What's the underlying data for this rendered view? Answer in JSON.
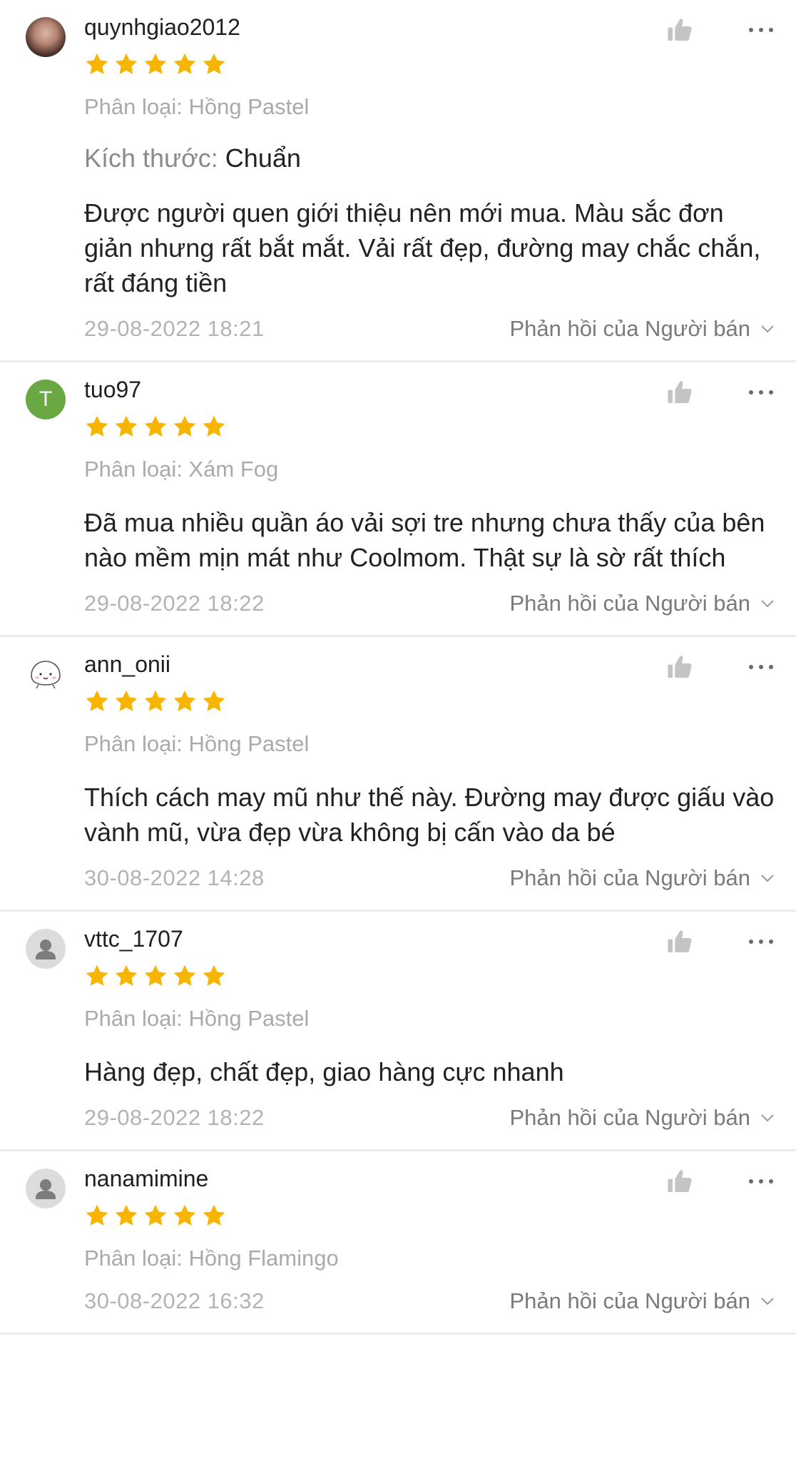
{
  "colors": {
    "star": "#f7b500",
    "letter_avatar_bg": "#6aa843",
    "default_avatar_bg": "#dcdcdc",
    "divider": "#ececec",
    "muted_text": "#aaaaaa"
  },
  "reviews": [
    {
      "username": "quynhgiao2012",
      "avatar_type": "photo",
      "avatar_letter": "",
      "rating": 5,
      "variation": "Phân loại: Hồng Pastel",
      "spec_key": "Kích thước:",
      "spec_value": "Chuẩn",
      "comment": "Được người quen giới thiệu nên mới mua. Màu sắc đơn giản nhưng rất bắt mắt. Vải rất đẹp, đường may chắc chắn, rất đáng tiền",
      "timestamp": "29-08-2022 18:21",
      "seller_reply_label": "Phản hồi của Người bán"
    },
    {
      "username": "tuo97",
      "avatar_type": "letter",
      "avatar_letter": "T",
      "rating": 5,
      "variation": "Phân loại: Xám Fog",
      "comment": "Đã mua nhiều quần áo vải sợi tre nhưng chưa thấy của bên nào mềm mịn mát như Coolmom. Thật sự là sờ rất thích",
      "timestamp": "29-08-2022 18:22",
      "seller_reply_label": "Phản hồi của Người bán"
    },
    {
      "username": "ann_onii",
      "avatar_type": "doodle",
      "avatar_letter": "",
      "rating": 5,
      "variation": "Phân loại: Hồng Pastel",
      "comment": "Thích cách may mũ như thế này. Đường may được giấu vào vành mũ, vừa đẹp vừa không bị cấn vào da bé",
      "timestamp": "30-08-2022 14:28",
      "seller_reply_label": "Phản hồi của Người bán"
    },
    {
      "username": "vttc_1707",
      "avatar_type": "default",
      "avatar_letter": "",
      "rating": 5,
      "variation": "Phân loại: Hồng Pastel",
      "comment": "Hàng đẹp, chất đẹp, giao hàng cực nhanh",
      "timestamp": "29-08-2022 18:22",
      "seller_reply_label": "Phản hồi của Người bán"
    },
    {
      "username": "nanamimine",
      "avatar_type": "default",
      "avatar_letter": "",
      "rating": 5,
      "variation": "Phân loại: Hồng Flamingo",
      "comment": "",
      "timestamp": "30-08-2022 16:32",
      "seller_reply_label": "Phản hồi của Người bán"
    }
  ]
}
